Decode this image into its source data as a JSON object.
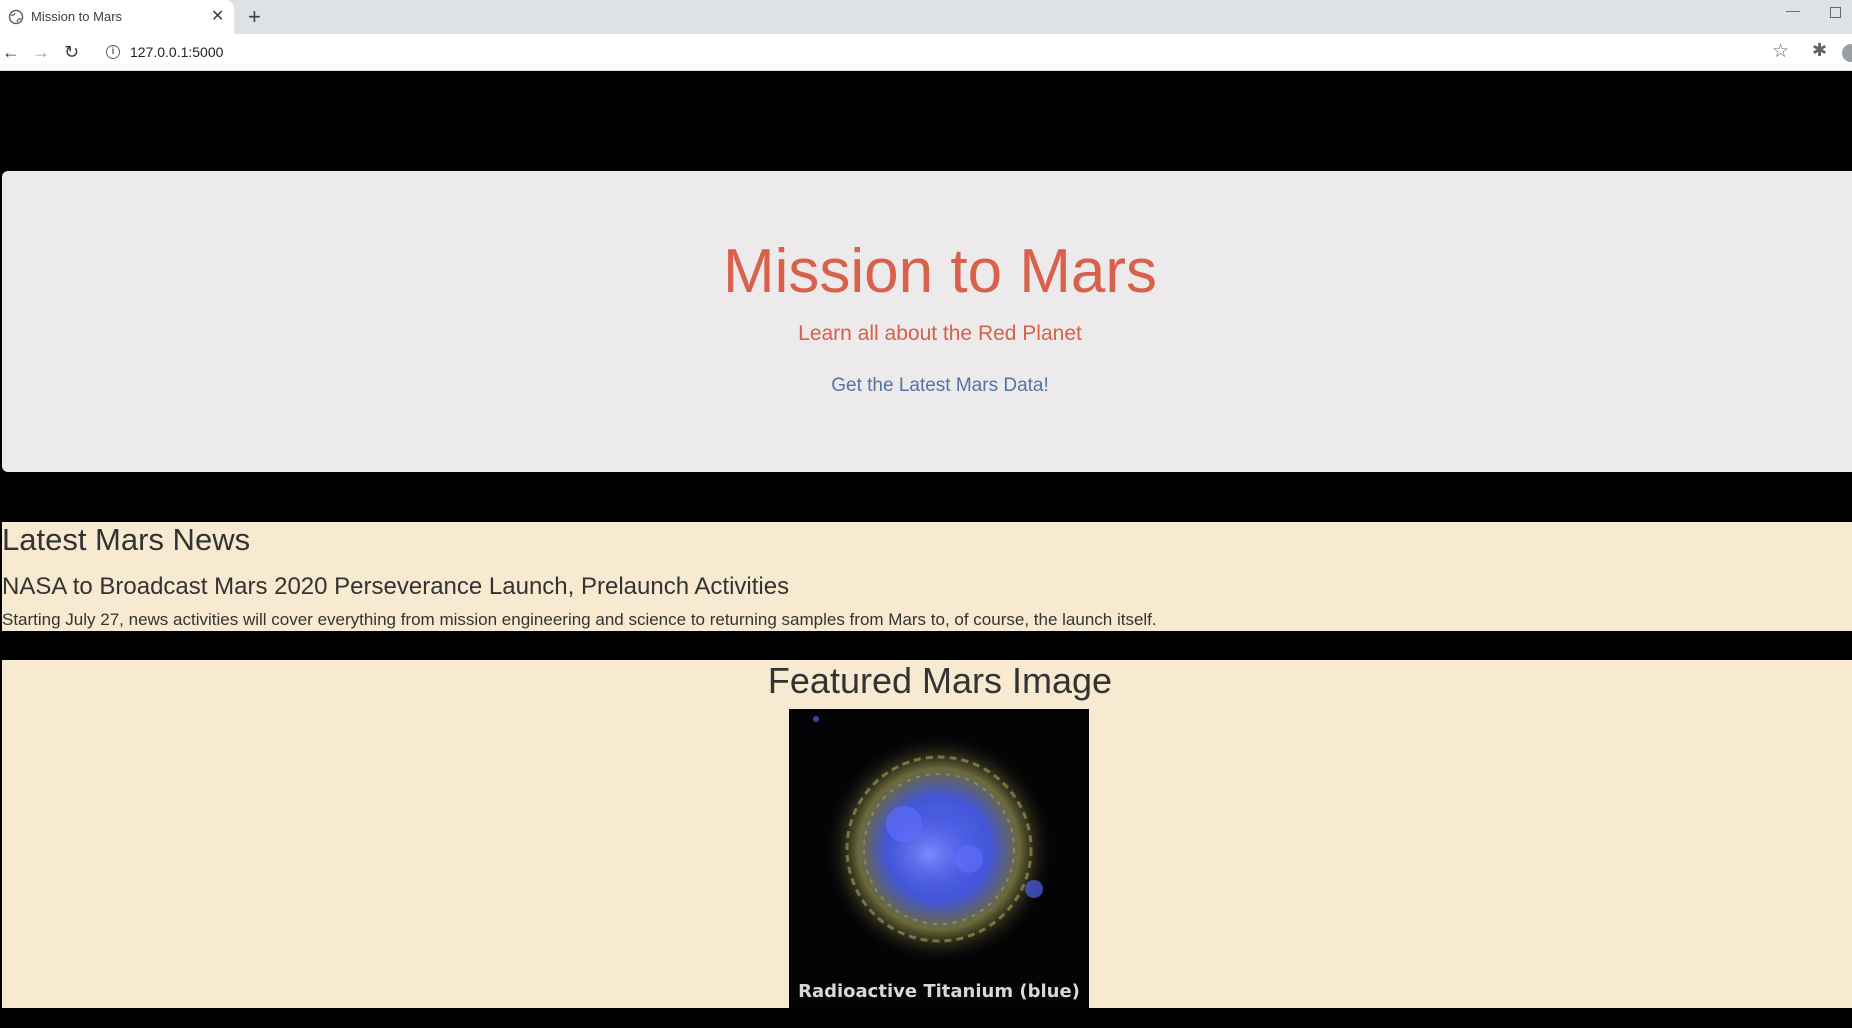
{
  "browser": {
    "tab_title": "Mission to Mars",
    "url": "127.0.0.1:5000"
  },
  "jumbotron": {
    "title": "Mission to Mars",
    "subtitle": "Learn all about the Red Planet",
    "button_label": "Get the Latest Mars Data!"
  },
  "news": {
    "heading": "Latest Mars News",
    "title": "NASA to Broadcast Mars 2020 Perseverance Launch, Prelaunch Activities",
    "teaser": "Starting July 27, news activities will cover everything from mission engineering and science to returning samples from Mars to, of course, the launch itself."
  },
  "featured": {
    "heading": "Featured Mars Image",
    "image_caption": "Radioactive Titanium (blue)"
  },
  "colors": {
    "accent_red": "#d9604a",
    "link_blue": "#5573a8",
    "section_bg": "#f7ead0"
  }
}
